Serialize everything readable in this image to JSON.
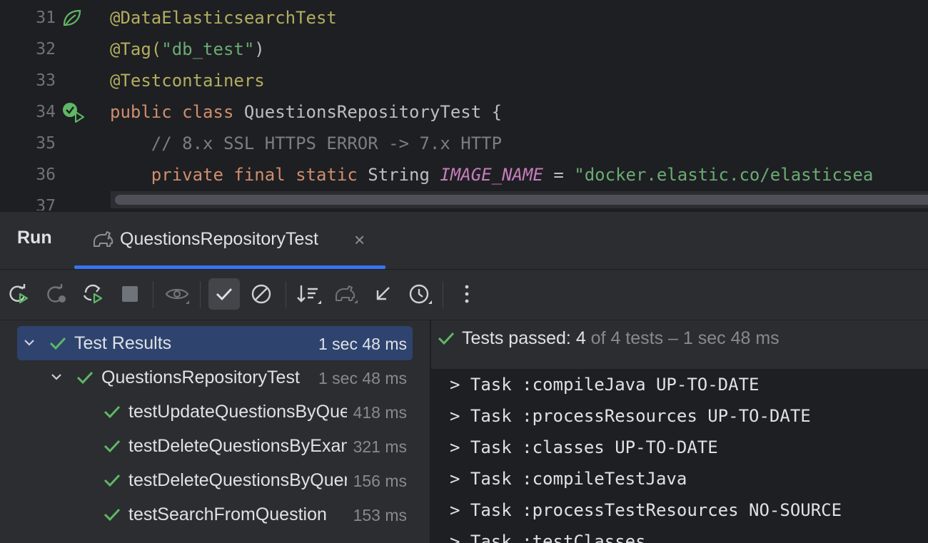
{
  "editor": {
    "lines": [
      {
        "num": "31",
        "parts": [
          {
            "t": "@DataElasticsearchTest",
            "c": "ann"
          }
        ]
      },
      {
        "num": "32",
        "parts": [
          {
            "t": "@Tag(",
            "c": "ann"
          },
          {
            "t": "\"db_test\"",
            "c": "str"
          },
          {
            "t": ")",
            "c": "plain"
          }
        ]
      },
      {
        "num": "33",
        "parts": [
          {
            "t": "@Testcontainers",
            "c": "ann"
          }
        ]
      },
      {
        "num": "34",
        "parts": [
          {
            "t": "public ",
            "c": "kw"
          },
          {
            "t": "class ",
            "c": "kw"
          },
          {
            "t": "QuestionsRepositoryTest {",
            "c": "plain"
          }
        ]
      },
      {
        "num": "35",
        "parts": [
          {
            "t": "    // 8.x SSL HTTPS ERROR -> 7.x HTTP",
            "c": "cmt"
          }
        ]
      },
      {
        "num": "36",
        "parts": [
          {
            "t": "    private ",
            "c": "kw"
          },
          {
            "t": "final ",
            "c": "kw"
          },
          {
            "t": "static ",
            "c": "kw"
          },
          {
            "t": "String ",
            "c": "plain"
          },
          {
            "t": "IMAGE_NAME",
            "c": "field"
          },
          {
            "t": " = ",
            "c": "plain"
          },
          {
            "t": "\"docker.elastic.co/elasticsea",
            "c": "str"
          }
        ]
      },
      {
        "num": "37",
        "parts": []
      }
    ]
  },
  "run": {
    "title": "Run",
    "tab_label": "QuestionsRepositoryTest",
    "tab_close": "×",
    "toolbar_icons": [
      "rerun-icon",
      "rerun-failed-icon",
      "toggle-auto-test-icon",
      "stop-icon",
      "show-ignored-icon",
      "show-passed-icon",
      "show-ignored-tests-icon",
      "sort-icon",
      "import-tests-icon",
      "collapse-icon",
      "history-icon",
      "more-icon"
    ]
  },
  "tree": {
    "root": {
      "label": "Test Results",
      "time": "1 sec 48 ms"
    },
    "suite": {
      "label": "QuestionsRepositoryTest",
      "time": "1 sec 48 ms"
    },
    "tests": [
      {
        "label": "testUpdateQuestionsByQuery",
        "time": "418 ms"
      },
      {
        "label": "testDeleteQuestionsByExample",
        "time": "321 ms"
      },
      {
        "label": "testDeleteQuestionsByQuery",
        "time": "156 ms"
      },
      {
        "label": "testSearchFromQuestion",
        "time": "153 ms"
      }
    ]
  },
  "console": {
    "summary_prefix": "Tests passed: ",
    "summary_count": "4",
    "summary_suffix": " of 4 tests – 1 sec 48 ms",
    "lines": [
      "> Task :compileJava UP-TO-DATE",
      "> Task :processResources UP-TO-DATE",
      "> Task :classes UP-TO-DATE",
      "> Task :compileTestJava",
      "> Task :processTestResources NO-SOURCE",
      "> Task :testClasses"
    ]
  },
  "colors": {
    "accent": "#3574f0",
    "success": "#5fb865",
    "selection": "#2e436e"
  }
}
